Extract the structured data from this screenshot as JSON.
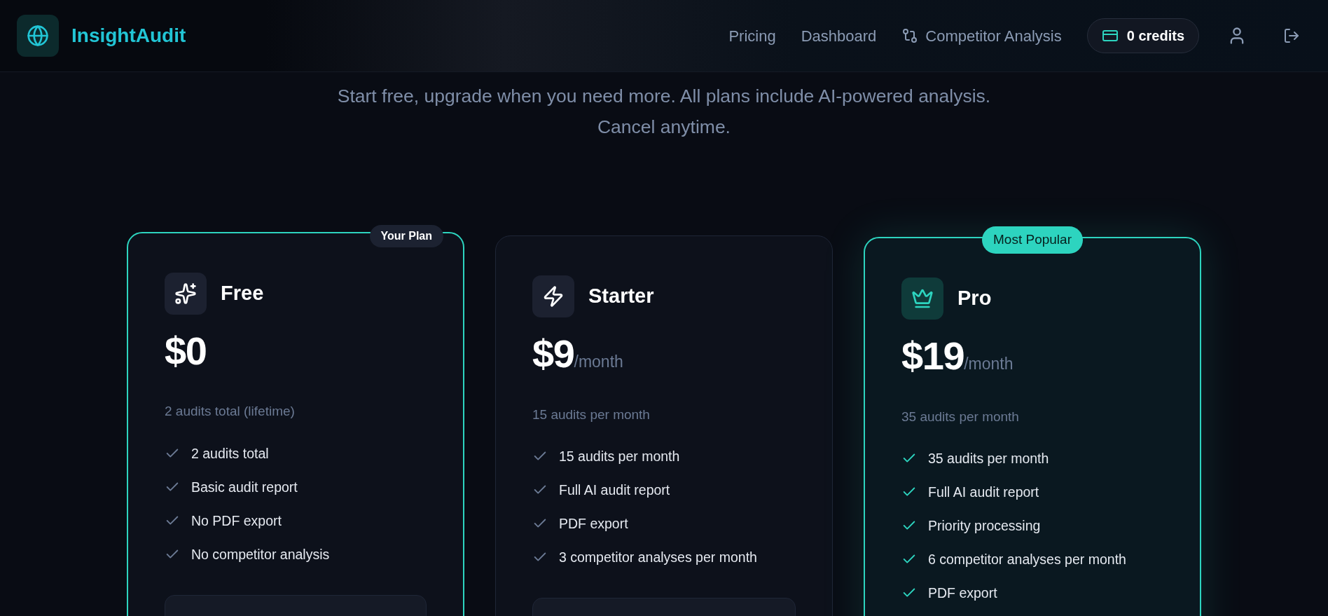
{
  "header": {
    "brand": "InsightAudit",
    "nav": [
      {
        "label": "Pricing",
        "kind": "text"
      },
      {
        "label": "Dashboard",
        "kind": "text"
      },
      {
        "label": "Competitor Analysis",
        "kind": "compare"
      }
    ],
    "credits": "0 credits"
  },
  "subtitle": "Start free, upgrade when you need more. All plans include AI-powered analysis. Cancel anytime.",
  "plans": [
    {
      "name": "Free",
      "kind": "sparkles",
      "price": "$0",
      "quota": "2 audits total (lifetime)",
      "highlighted": true,
      "featured": false,
      "badge": {
        "text": "Your Plan",
        "kind": "current"
      },
      "features": [
        "2 audits total",
        "Basic audit report",
        "No PDF export",
        "No competitor analysis"
      ],
      "button": true
    },
    {
      "name": "Starter",
      "kind": "bolt",
      "price": "$9",
      "period": "/month",
      "quota": "15 audits per month",
      "highlighted": false,
      "featured": false,
      "features": [
        "15 audits per month",
        "Full AI audit report",
        "PDF export",
        "3 competitor analyses per month"
      ],
      "button": true
    },
    {
      "name": "Pro",
      "kind": "crown",
      "price": "$19",
      "period": "/month",
      "quota": "35 audits per month",
      "highlighted": true,
      "featured": true,
      "badge": {
        "text": "Most Popular",
        "kind": "popular"
      },
      "features": [
        "35 audits per month",
        "Full AI audit report",
        "Priority processing",
        "6 competitor analyses per month",
        "PDF export"
      ]
    }
  ]
}
